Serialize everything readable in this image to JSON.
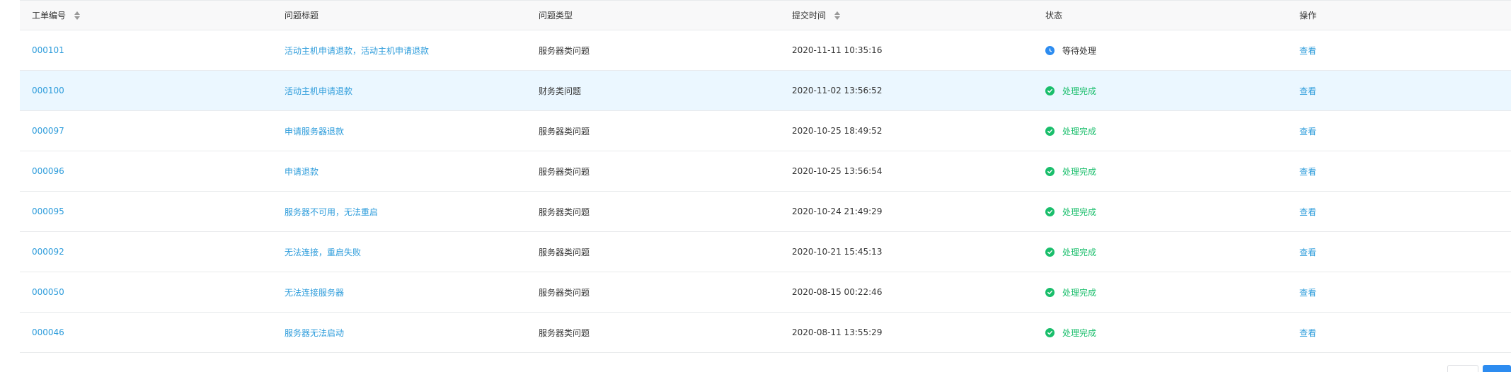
{
  "table": {
    "headers": {
      "id": "工单编号",
      "title": "问题标题",
      "type": "问题类型",
      "time": "提交时间",
      "status": "状态",
      "op": "操作"
    },
    "rows": [
      {
        "id": "000101",
        "title": "活动主机申请退款，活动主机申请退款",
        "type": "服务器类问题",
        "time": "2020-11-11 10:35:16",
        "status": "等待处理",
        "status_kind": "wait",
        "op": "查看"
      },
      {
        "id": "000100",
        "title": "活动主机申请退款",
        "type": "财务类问题",
        "time": "2020-11-02 13:56:52",
        "status": "处理完成",
        "status_kind": "done",
        "op": "查看"
      },
      {
        "id": "000097",
        "title": "申请服务器退款",
        "type": "服务器类问题",
        "time": "2020-10-25 18:49:52",
        "status": "处理完成",
        "status_kind": "done",
        "op": "查看"
      },
      {
        "id": "000096",
        "title": "申请退款",
        "type": "服务器类问题",
        "time": "2020-10-25 13:56:54",
        "status": "处理完成",
        "status_kind": "done",
        "op": "查看"
      },
      {
        "id": "000095",
        "title": "服务器不可用，无法重启",
        "type": "服务器类问题",
        "time": "2020-10-24 21:49:29",
        "status": "处理完成",
        "status_kind": "done",
        "op": "查看"
      },
      {
        "id": "000092",
        "title": "无法连接，重启失败",
        "type": "服务器类问题",
        "time": "2020-10-21 15:45:13",
        "status": "处理完成",
        "status_kind": "done",
        "op": "查看"
      },
      {
        "id": "000050",
        "title": "无法连接服务器",
        "type": "服务器类问题",
        "time": "2020-08-15 00:22:46",
        "status": "处理完成",
        "status_kind": "done",
        "op": "查看"
      },
      {
        "id": "000046",
        "title": "服务器无法启动",
        "type": "服务器类问题",
        "time": "2020-08-11 13:55:29",
        "status": "处理完成",
        "status_kind": "done",
        "op": "查看"
      }
    ]
  },
  "icons": {
    "wait": "clock-icon",
    "done": "check-circle-icon",
    "sort": "sort-icon"
  },
  "colors": {
    "link": "#2d9cdb",
    "done": "#19be6b",
    "wait": "#2d8cf0",
    "row_highlight": "#ebf7ff"
  }
}
